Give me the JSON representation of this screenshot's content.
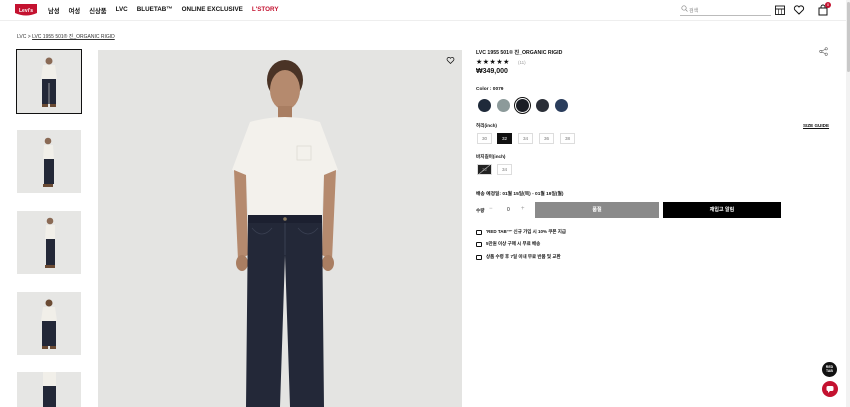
{
  "header": {
    "logo_text": "Levi's",
    "nav": [
      "남성",
      "여성",
      "신상품",
      "LVC",
      "BLUETAB™",
      "ONLINE EXCLUSIVE",
      "L'STORY"
    ],
    "search_placeholder": "검색",
    "icons": [
      "store-icon",
      "heart-icon",
      "bag-icon"
    ],
    "cart_count": "0"
  },
  "breadcrumb": {
    "root": "LVC",
    "sep": ">",
    "current": "LVC 1955 501® 진_ORGANIC RIGID"
  },
  "product": {
    "title": "LVC 1955 501® 진_ORGANIC RIGID",
    "stars": "★★★★★",
    "review_count": "(11)",
    "rating": 5,
    "price": "₩349,000",
    "color_label": "Color : 0079",
    "colors": [
      "#1f2a3a",
      "#8c9a9a",
      "#1a1d24",
      "#2b2f38",
      "#2a3d5c"
    ],
    "waist_label": "허리(inch)",
    "size_guide": "SIZE GUIDE",
    "waist_sizes": [
      "30",
      "32",
      "34",
      "36",
      "38"
    ],
    "waist_selected": "32",
    "length_label": "바지길이(inch)",
    "length_sizes": [
      "32",
      "34"
    ],
    "delivery": "배송 예정일: 01월 15일(목) - 01월 19일(월)",
    "qty_label": "수량",
    "qty_minus": "−",
    "qty_value": "0",
    "qty_plus": "+",
    "soldout_label": "품절",
    "notify_label": "재입고 알림",
    "benefits": [
      "'RED TAB™' 신규 가입 시 10% 쿠폰 지급",
      "5만원 이상 구매 시 무료 배송",
      "상품 수령 후 7일 이내 무료 반품 및 교환"
    ]
  },
  "floating": {
    "redtab_label": "RED TAB"
  },
  "colors": {
    "brand_red": "#c41230",
    "soldout_gray": "#8a8a8a"
  }
}
